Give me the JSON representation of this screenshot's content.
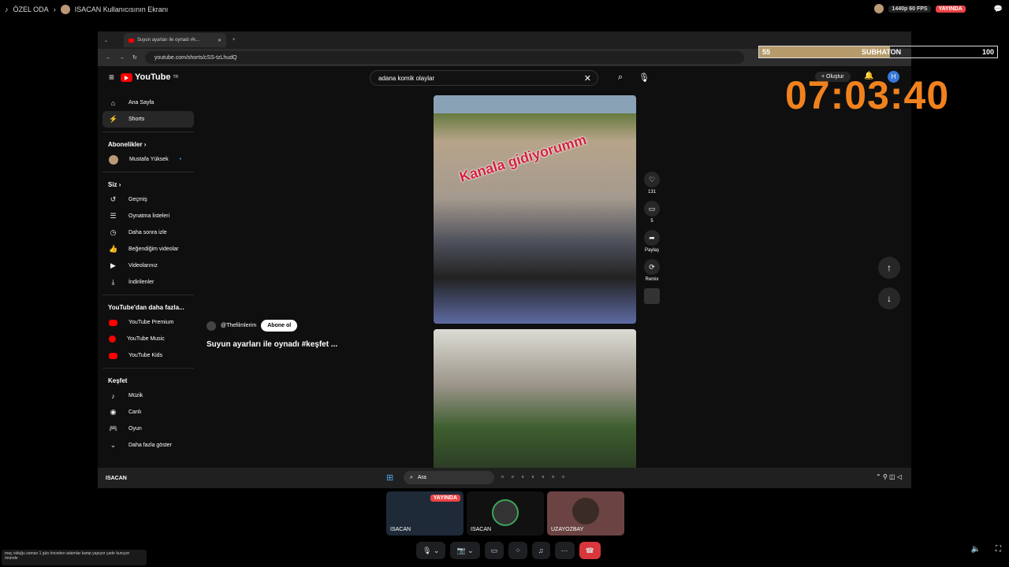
{
  "discord": {
    "channel": "ÖZEL ODA",
    "stream_title": "ISACAN Kullanıcısının Ekranı",
    "quality": "1440p 60 FPS",
    "live_badge": "YAYINDA"
  },
  "browser": {
    "tab_title": "Suyun ayarları ile oynadı #k...",
    "url": "youtube.com/shorts/cSS-tzLhudQ"
  },
  "youtube": {
    "logo": "YouTube",
    "region": "TR",
    "search_value": "adana komik olaylar",
    "create_label": "Oluştur",
    "user_initial": "H",
    "sidebar": {
      "home": "Ana Sayfa",
      "shorts": "Shorts",
      "subs_header": "Abonelikler",
      "sub1": "Mustafa Yüksek",
      "you_header": "Siz",
      "history": "Geçmiş",
      "playlists": "Oynatma listeleri",
      "watch_later": "Daha sonra izle",
      "liked": "Beğendiğim videolar",
      "your_videos": "Videolarınız",
      "downloads": "İndirilenler",
      "more_header": "YouTube'dan daha fazla...",
      "premium": "YouTube Premium",
      "music": "YouTube Music",
      "kids": "YouTube Kids",
      "explore_header": "Keşfet",
      "music2": "Müzik",
      "live": "Canlı",
      "gaming": "Oyun",
      "show_more": "Daha fazla göster"
    },
    "short": {
      "overlay": "Kanala gidiyorumm",
      "channel": "@Thefilmlerim",
      "subscribe": "Abone ol",
      "title": "Suyun ayarları ile oynadı #keşfet ...",
      "likes": "131",
      "comments": "5",
      "share": "Paylaş",
      "remix": "Remix"
    }
  },
  "taskbar": {
    "search": "Ara",
    "user": "ISACAN"
  },
  "overlay": {
    "timer": "07:03:40",
    "sub_left": "55",
    "sub_label": "SUBHATON",
    "sub_right": "100",
    "sub_progress": 0.55
  },
  "participants": [
    {
      "name": "ISACAN",
      "badge": "YAYINDA"
    },
    {
      "name": "ISACAN"
    },
    {
      "name": "UZAYOZBAY"
    }
  ],
  "chat_line": "maç olduğu zaman 1 gün önceden adamlar kamp yapıyor çadır kuruyor önünde"
}
